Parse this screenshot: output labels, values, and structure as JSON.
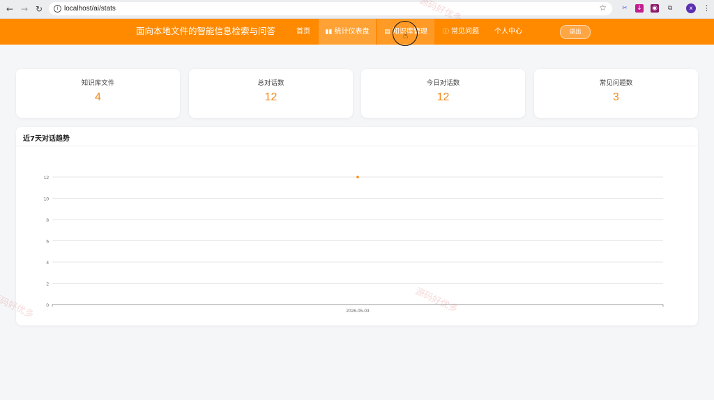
{
  "browser": {
    "url": "localhost/ai/stats",
    "back_icon": "arrow-left-icon",
    "forward_icon": "arrow-right-icon",
    "reload_icon": "reload-icon",
    "profile_initial": "x"
  },
  "header": {
    "title": "面向本地文件的智能信息检索与问答",
    "nav": [
      {
        "label": "首页",
        "icon": ""
      },
      {
        "label": "统计仪表盘",
        "icon": "bar-chart-icon"
      },
      {
        "label": "知识库管理",
        "icon": "document-icon"
      },
      {
        "label": "常见问题",
        "icon": "question-circle-icon"
      },
      {
        "label": "个人中心",
        "icon": ""
      }
    ],
    "logout": "退出",
    "accent_color": "#ff8a00"
  },
  "stats": [
    {
      "label": "知识库文件",
      "value": "4"
    },
    {
      "label": "总对话数",
      "value": "12"
    },
    {
      "label": "今日对话数",
      "value": "12"
    },
    {
      "label": "常见问题数",
      "value": "3"
    }
  ],
  "chart_title": "近7天对话趋势",
  "chart_data": {
    "type": "line",
    "title": "近7天对话趋势",
    "x": [
      "2026-05-03"
    ],
    "series": [
      {
        "values": [
          12
        ]
      }
    ],
    "ylim": [
      0,
      12
    ],
    "yticks": [
      "0",
      "2",
      "4",
      "6",
      "8",
      "10",
      "12"
    ],
    "grid": true
  },
  "watermark": "源码好优多"
}
